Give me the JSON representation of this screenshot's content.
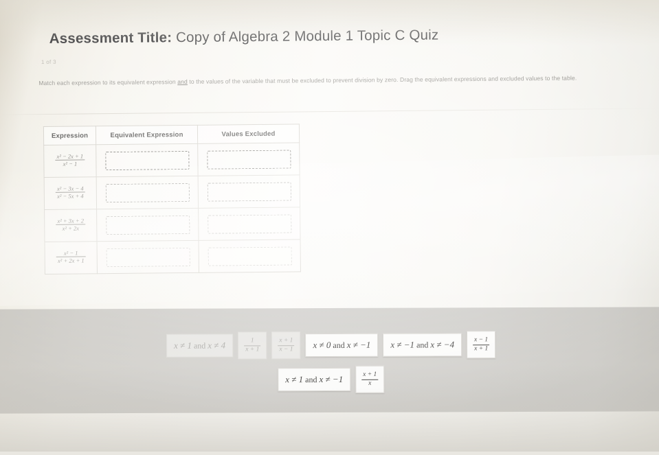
{
  "header": {
    "label": "Assessment Title:",
    "assessment_name": "Copy of Algebra 2 Module 1 Topic C Quiz",
    "page_counter": "1 of 3"
  },
  "instructions": {
    "part1": "Match each expression to its equivalent expression ",
    "emphasis": "and",
    "part2": " to the values of the variable that must be excluded to prevent division by zero.  Drag the equivalent expressions and excluded values to the table."
  },
  "table": {
    "headers": [
      "Expression",
      "Equivalent Expression",
      "Values Excluded"
    ],
    "rows": [
      {
        "expression": {
          "numerator": "x² − 2x + 1",
          "denominator": "x² − 1"
        },
        "equivalent_expression": "",
        "values_excluded": ""
      },
      {
        "expression": {
          "numerator": "x² − 3x − 4",
          "denominator": "x² − 5x + 4"
        },
        "equivalent_expression": "",
        "values_excluded": ""
      },
      {
        "expression": {
          "numerator": "x² + 3x + 2",
          "denominator": "x² + 2x"
        },
        "equivalent_expression": "",
        "values_excluded": ""
      },
      {
        "expression": {
          "numerator": "x² − 1",
          "denominator": "x² + 2x + 1"
        },
        "equivalent_expression": "",
        "values_excluded": ""
      }
    ],
    "dropzone_placeholder": ""
  },
  "answer_bank": {
    "rows": [
      [
        {
          "type": "text",
          "text": "x ≠ 1 and x ≠ 4",
          "lhs": "x ≠ 1",
          "and": "and",
          "rhs": "x ≠ 4",
          "faded": true
        },
        {
          "type": "fraction",
          "numerator": "1",
          "denominator": "x + 1",
          "faded": true
        },
        {
          "type": "fraction",
          "numerator": "x + 1",
          "denominator": "x − 1",
          "faded": true
        },
        {
          "type": "text",
          "text": "x ≠ 0 and x ≠ −1",
          "lhs": "x ≠ 0",
          "and": "and",
          "rhs": "x ≠ −1",
          "faded": false
        },
        {
          "type": "text",
          "text": "x ≠ −1 and x ≠ −4",
          "lhs": "x ≠ −1",
          "and": "and",
          "rhs": "x ≠ −4",
          "faded": false
        },
        {
          "type": "fraction",
          "numerator": "x − 1",
          "denominator": "x + 1",
          "faded": false
        }
      ],
      [
        {
          "type": "text",
          "text": "x ≠ 1 and x ≠ −1",
          "lhs": "x ≠ 1",
          "and": "and",
          "rhs": "x ≠ −1",
          "faded": false
        },
        {
          "type": "fraction",
          "numerator": "x + 1",
          "denominator": "x",
          "faded": false
        }
      ]
    ]
  },
  "colors": {
    "page": "#f8f7f3",
    "bank_panel": "#adaba7",
    "table_border": "#cfccc4",
    "text": "#3a3a3c"
  }
}
